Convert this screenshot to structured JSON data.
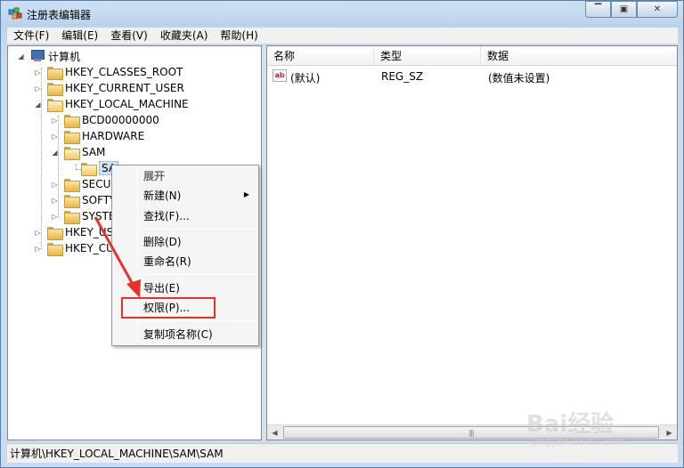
{
  "window": {
    "title": "注册表编辑器",
    "icon": "regedit-icon",
    "controls": {
      "minimize": "▔",
      "maximize": "▣",
      "close": "✕"
    }
  },
  "menubar": {
    "items": [
      {
        "label": "文件(F)"
      },
      {
        "label": "编辑(E)"
      },
      {
        "label": "查看(V)"
      },
      {
        "label": "收藏夹(A)"
      },
      {
        "label": "帮助(H)"
      }
    ]
  },
  "tree": {
    "root": "计算机",
    "nodes": [
      {
        "label": "HKEY_CLASSES_ROOT",
        "expanded": false
      },
      {
        "label": "HKEY_CURRENT_USER",
        "expanded": false
      },
      {
        "label": "HKEY_LOCAL_MACHINE",
        "expanded": true
      },
      {
        "label": "BCD00000000",
        "expanded": false
      },
      {
        "label": "HARDWARE",
        "expanded": false
      },
      {
        "label": "SAM",
        "expanded": true
      },
      {
        "label": "SAM",
        "selected": true
      },
      {
        "label": "SECURITY",
        "expanded": false
      },
      {
        "label": "SOFTWARE",
        "expanded": false
      },
      {
        "label": "SYSTEM",
        "expanded": false
      },
      {
        "label": "HKEY_USERS",
        "expanded": false
      },
      {
        "label": "HKEY_CURRENT_CONFIG",
        "expanded": false
      }
    ],
    "visible_text": [
      "SA",
      "SECUI",
      "SOFTV",
      "SYSTE",
      "HKEY_US",
      "HKEY_CU"
    ]
  },
  "list": {
    "columns": [
      "名称",
      "类型",
      "数据"
    ],
    "rows": [
      {
        "name": "(默认)",
        "type": "REG_SZ",
        "data": "(数值未设置)",
        "icon": "string-value-icon"
      }
    ]
  },
  "context_menu": {
    "items": [
      {
        "label": "展开",
        "bold": true
      },
      {
        "label": "新建(N)",
        "submenu": true
      },
      {
        "label": "查找(F)..."
      },
      {
        "label": "删除(D)"
      },
      {
        "label": "重命名(R)"
      },
      {
        "label": "导出(E)"
      },
      {
        "label": "权限(P)...",
        "highlighted": true
      },
      {
        "label": "复制项名称(C)"
      }
    ]
  },
  "statusbar": {
    "path": "计算机\\HKEY_LOCAL_MACHINE\\SAM\\SAM"
  },
  "watermark": {
    "text": "Bai经验",
    "sub": "jingyan.baidu.com"
  },
  "colors": {
    "highlight": "#e6322d",
    "selection": "#cce4f7",
    "accent": "#3b6fb6"
  }
}
